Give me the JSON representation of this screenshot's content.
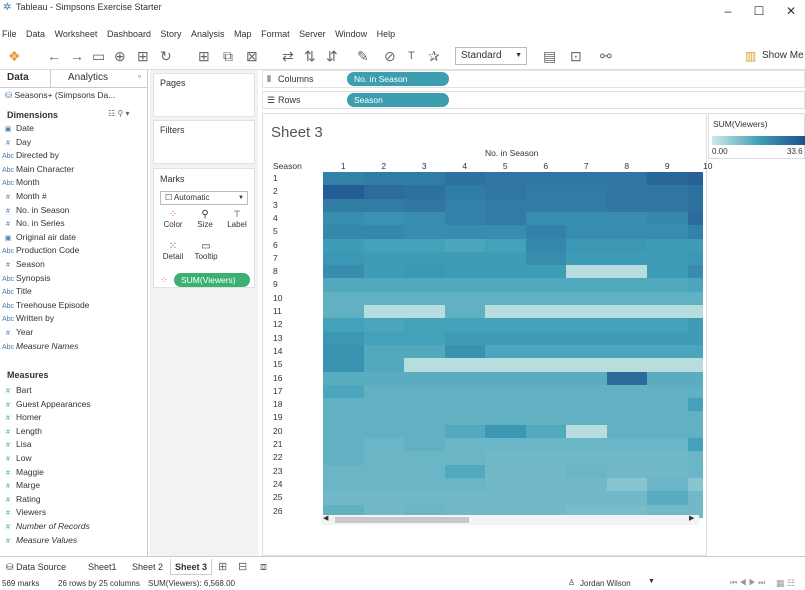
{
  "window": {
    "title": "Tableau - Simpsons Exercise Starter",
    "minimize": "–",
    "maximize": "☐",
    "close": "✕"
  },
  "menu": [
    "File",
    "Data",
    "Worksheet",
    "Dashboard",
    "Story",
    "Analysis",
    "Map",
    "Format",
    "Server",
    "Window",
    "Help"
  ],
  "toolbar": {
    "fit_select": "Standard",
    "show_me": "Show Me"
  },
  "left_pane": {
    "tab_data": "Data",
    "tab_analytics": "Analytics",
    "datasource": "Seasons+ (Simpsons Da...",
    "dimensions_header": "Dimensions",
    "dimensions": [
      {
        "type": "date",
        "label": "Date",
        "italic": false
      },
      {
        "type": "num",
        "label": "Day",
        "italic": false
      },
      {
        "type": "abc",
        "label": "Directed by",
        "italic": false
      },
      {
        "type": "abc",
        "label": "Main Character",
        "italic": false
      },
      {
        "type": "abc",
        "label": "Month",
        "italic": false
      },
      {
        "type": "num",
        "label": "Month #",
        "italic": false
      },
      {
        "type": "num",
        "label": "No. in Season",
        "italic": false
      },
      {
        "type": "num",
        "label": "No. in Series",
        "italic": false
      },
      {
        "type": "date",
        "label": "Original air date",
        "italic": false
      },
      {
        "type": "abc",
        "label": "Production Code",
        "italic": false
      },
      {
        "type": "num",
        "label": "Season",
        "italic": false
      },
      {
        "type": "abc",
        "label": "Synopsis",
        "italic": false
      },
      {
        "type": "abc",
        "label": "Title",
        "italic": false
      },
      {
        "type": "abc",
        "label": "Treehouse Episode",
        "italic": false
      },
      {
        "type": "abc",
        "label": "Written by",
        "italic": false
      },
      {
        "type": "num",
        "label": "Year",
        "italic": false
      },
      {
        "type": "abc",
        "label": "Measure Names",
        "italic": true
      }
    ],
    "measures_header": "Measures",
    "measures": [
      {
        "label": "Bart",
        "italic": false
      },
      {
        "label": "Guest Appearances",
        "italic": false
      },
      {
        "label": "Homer",
        "italic": false
      },
      {
        "label": "Length",
        "italic": false
      },
      {
        "label": "Lisa",
        "italic": false
      },
      {
        "label": "Low",
        "italic": false
      },
      {
        "label": "Maggie",
        "italic": false
      },
      {
        "label": "Marge",
        "italic": false
      },
      {
        "label": "Rating",
        "italic": false
      },
      {
        "label": "Viewers",
        "italic": false
      },
      {
        "label": "Number of Records",
        "italic": true
      },
      {
        "label": "Measure Values",
        "italic": true
      }
    ]
  },
  "cards": {
    "pages": "Pages",
    "filters": "Filters",
    "marks": "Marks",
    "mark_type": "Automatic",
    "color": "Color",
    "size": "Size",
    "label": "Label",
    "detail": "Detail",
    "tooltip": "Tooltip",
    "sum_viewers": "SUM(Viewers)"
  },
  "shelves": {
    "columns_label": "Columns",
    "rows_label": "Rows",
    "columns_pill": "No. in Season",
    "rows_pill": "Season"
  },
  "sheet": {
    "title": "Sheet 3",
    "col_header": "No. in Season",
    "row_header": "Season"
  },
  "legend": {
    "title": "SUM(Viewers)",
    "min": "0.00",
    "max": "33.6"
  },
  "chart_data": {
    "type": "heatmap",
    "x_label": "No. in Season",
    "y_label": "Season",
    "x_ticks": [
      "1",
      "2",
      "3",
      "4",
      "5",
      "6",
      "7",
      "8",
      "9",
      "10"
    ],
    "rows": [
      "1",
      "2",
      "3",
      "4",
      "5",
      "6",
      "7",
      "8",
      "9",
      "10",
      "11",
      "12",
      "13",
      "14",
      "15",
      "16",
      "17",
      "18",
      "19",
      "20",
      "21",
      "22",
      "23",
      "24",
      "25",
      "26"
    ],
    "color_scale": {
      "measure": "SUM(Viewers)",
      "min": 0.0,
      "max": 33.6,
      "low_color": "#cfe9e6",
      "high_color": "#1f4e8c"
    },
    "values": [
      [
        24,
        25,
        25,
        27,
        26,
        26,
        26,
        26,
        29,
        30
      ],
      [
        31,
        28,
        27,
        25,
        26,
        25,
        25,
        26,
        26,
        27
      ],
      [
        25,
        25,
        26,
        24,
        25,
        25,
        25,
        26,
        26,
        27
      ],
      [
        22,
        21,
        22,
        24,
        25,
        22,
        22,
        22,
        23,
        28
      ],
      [
        23,
        23,
        22,
        22,
        22,
        24,
        22,
        22,
        22,
        24
      ],
      [
        19,
        18,
        18,
        17,
        18,
        23,
        20,
        20,
        19,
        19
      ],
      [
        20,
        19,
        19,
        19,
        19,
        22,
        19,
        19,
        19,
        20
      ],
      [
        22,
        19,
        20,
        19,
        19,
        19,
        3,
        3,
        19,
        22
      ],
      [
        16,
        16,
        16,
        16,
        16,
        16,
        16,
        16,
        16,
        17
      ],
      [
        14,
        14,
        14,
        14,
        14,
        14,
        14,
        14,
        14,
        14
      ],
      [
        14,
        3,
        3,
        14,
        3,
        3,
        3,
        3,
        3,
        3
      ],
      [
        18,
        17,
        18,
        18,
        18,
        18,
        18,
        18,
        18,
        19
      ],
      [
        20,
        18,
        18,
        19,
        19,
        19,
        19,
        19,
        19,
        19
      ],
      [
        21,
        16,
        16,
        21,
        17,
        17,
        17,
        17,
        17,
        17
      ],
      [
        21,
        16,
        3,
        3,
        3,
        3,
        3,
        3,
        3,
        3
      ],
      [
        15,
        15,
        15,
        15,
        15,
        15,
        15,
        28,
        15,
        15
      ],
      [
        17,
        14,
        14,
        14,
        14,
        14,
        14,
        14,
        14,
        14
      ],
      [
        14,
        14,
        14,
        14,
        14,
        14,
        14,
        14,
        14,
        18
      ],
      [
        14,
        14,
        14,
        14,
        14,
        14,
        14,
        14,
        14,
        14
      ],
      [
        14,
        14,
        14,
        16,
        20,
        16,
        3,
        14,
        14,
        14
      ],
      [
        14,
        13,
        14,
        13,
        13,
        13,
        13,
        13,
        13,
        18
      ],
      [
        14,
        13,
        13,
        13,
        12,
        12,
        12,
        12,
        12,
        13
      ],
      [
        13,
        13,
        13,
        16,
        12,
        12,
        13,
        12,
        12,
        13
      ],
      [
        13,
        13,
        13,
        13,
        12,
        12,
        12,
        9,
        13,
        9
      ],
      [
        12,
        12,
        12,
        12,
        12,
        12,
        12,
        12,
        15,
        12
      ],
      [
        14,
        12,
        13,
        12,
        12,
        12,
        11,
        11,
        12,
        12
      ]
    ]
  },
  "status_tabs": {
    "datasource": "Data Source",
    "sheet1": "Sheet1",
    "sheet2": "Sheet 2",
    "sheet3": "Sheet 3"
  },
  "status": {
    "marks": "569 marks",
    "dims": "26 rows by 25 columns",
    "sum": "SUM(Viewers): 6,568.00",
    "user": "Jordan Wilson"
  }
}
